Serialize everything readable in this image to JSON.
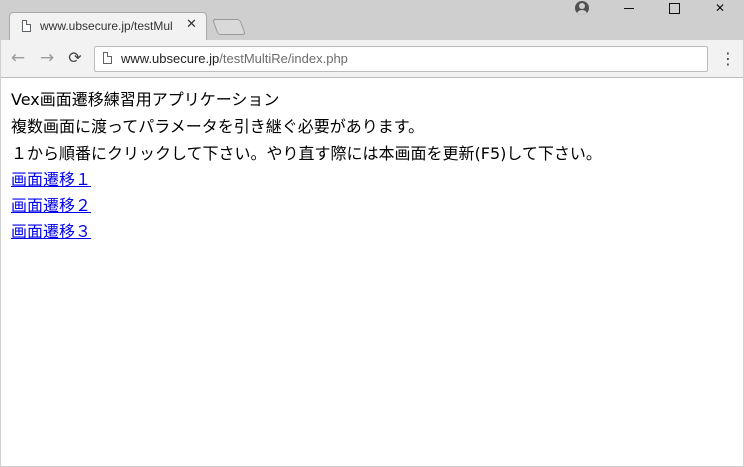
{
  "browser": {
    "tab": {
      "title": "www.ubsecure.jp/testMul",
      "favicon": "page-icon",
      "close_label": "✕"
    },
    "window_controls": {
      "minimize_icon": "minimize-icon",
      "maximize_icon": "maximize-icon",
      "close_label": "✕",
      "profile_icon": "user-profile-icon"
    },
    "toolbar": {
      "back_label": "←",
      "forward_label": "→",
      "reload_label": "⟳",
      "menu_label": "⋮",
      "url_host": "www.ubsecure.jp",
      "url_path": "/testMultiRe/index.php"
    }
  },
  "page": {
    "heading": "Vex画面遷移練習用アプリケーション",
    "description": "複数画面に渡ってパラメータを引き継ぐ必要があります。",
    "instruction": "１から順番にクリックして下さい。やり直す際には本画面を更新(F5)して下さい。",
    "links": [
      {
        "label": "画面遷移１"
      },
      {
        "label": "画面遷移２"
      },
      {
        "label": "画面遷移３"
      }
    ]
  },
  "colors": {
    "link": "#0000ee",
    "tabstrip": "#cfcfcf",
    "toolbar": "#f2f2f2"
  }
}
